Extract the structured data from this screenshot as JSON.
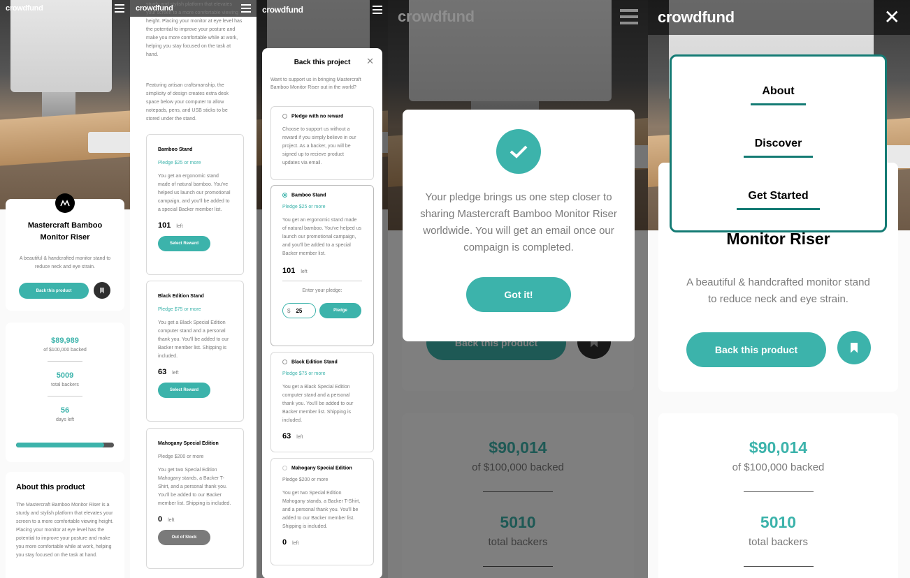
{
  "colors": {
    "accent": "#3cb3ab",
    "accent_dark": "#147b74",
    "text": "#2f2f2f",
    "muted": "#7a7a7a"
  },
  "brand": "crowdfund",
  "product": {
    "title_line1": "Mastercraft Bamboo",
    "title_line2": "Monitor Riser",
    "title_tail": "Monitor Riser",
    "description": "A beautiful & handcrafted monitor stand to reduce neck and eye strain.",
    "back_button": "Back this product"
  },
  "stats_p1": {
    "amount": "$89,989",
    "amount_caption": "of $100,000 backed",
    "backers": "5009",
    "backers_caption": "total backers",
    "days": "56",
    "days_caption": "days left",
    "progress": 0.9
  },
  "stats_p4": {
    "amount": "$90,014",
    "amount_caption": "of $100,000 backed",
    "backers": "5010",
    "backers_caption": "total backers"
  },
  "about": {
    "heading": "About this product",
    "para1": "The Mastercraft Bamboo Monitor Riser is a sturdy and stylish platform that elevates your screen to a more comfortable viewing height. Placing your monitor at eye level has the potential to improve your posture and make you more comfortable while at work, helping you stay focused on the task at hand.",
    "para2": "Featuring artisan craftsmanship, the simplicity of design creates extra desk space below your computer to allow notepads, pens, and USB sticks to be stored under the stand.",
    "para1_cut": "The Mastercraft Bamboo Monitor Riser is a sturdy and stylish platform that elevates your screen to a more comfortable viewing height. Placing your monitor at eye level has the potential to improve your posture and make you more comfortable while at work, helping you stay focused on the task at hand."
  },
  "rewards": [
    {
      "name": "Bamboo Stand",
      "pledge": "Pledge $25 or more",
      "desc": "You get an ergonomic stand made of natural bamboo. You've helped us launch our promotional campaign, and you'll be added to a special Backer member list.",
      "left": "101",
      "left_label": "left",
      "button": "Select Reward"
    },
    {
      "name": "Black Edition Stand",
      "pledge": "Pledge $75 or more",
      "desc": "You get a Black Special Edition computer stand and a personal thank you. You'll be added to our Backer member list. Shipping is included.",
      "left": "63",
      "left_label": "left",
      "button": "Select Reward"
    },
    {
      "name": "Mahogany Special Edition",
      "pledge": "Pledge $200 or more",
      "desc": "You get two Special Edition Mahogany stands, a Backer T-Shirt, and a personal thank you. You'll be added to our Backer member list. Shipping is included.",
      "left": "0",
      "left_label": "left",
      "button": "Out of Stock"
    }
  ],
  "modal": {
    "title": "Back this project",
    "intro": "Want to support us in bringing Mastercraft Bamboo Monitor Riser out in the world?",
    "no_reward_name": "Pledge with no reward",
    "no_reward_desc": "Choose to support us without a reward if you simply believe in our project. As a backer, you will be signed up to recieve product updates via email.",
    "enter_pledge": "Enter your pledge:",
    "currency": "$",
    "pledge_value": "25",
    "pledge_button": "Pledge"
  },
  "success": {
    "message": "Your pledge brings us one step closer to sharing Mastercraft Bamboo Monitor Riser worldwide. You will get an email once our compaign is completed.",
    "button": "Got it!"
  },
  "menu": {
    "items": [
      "About",
      "Discover",
      "Get Started"
    ]
  }
}
